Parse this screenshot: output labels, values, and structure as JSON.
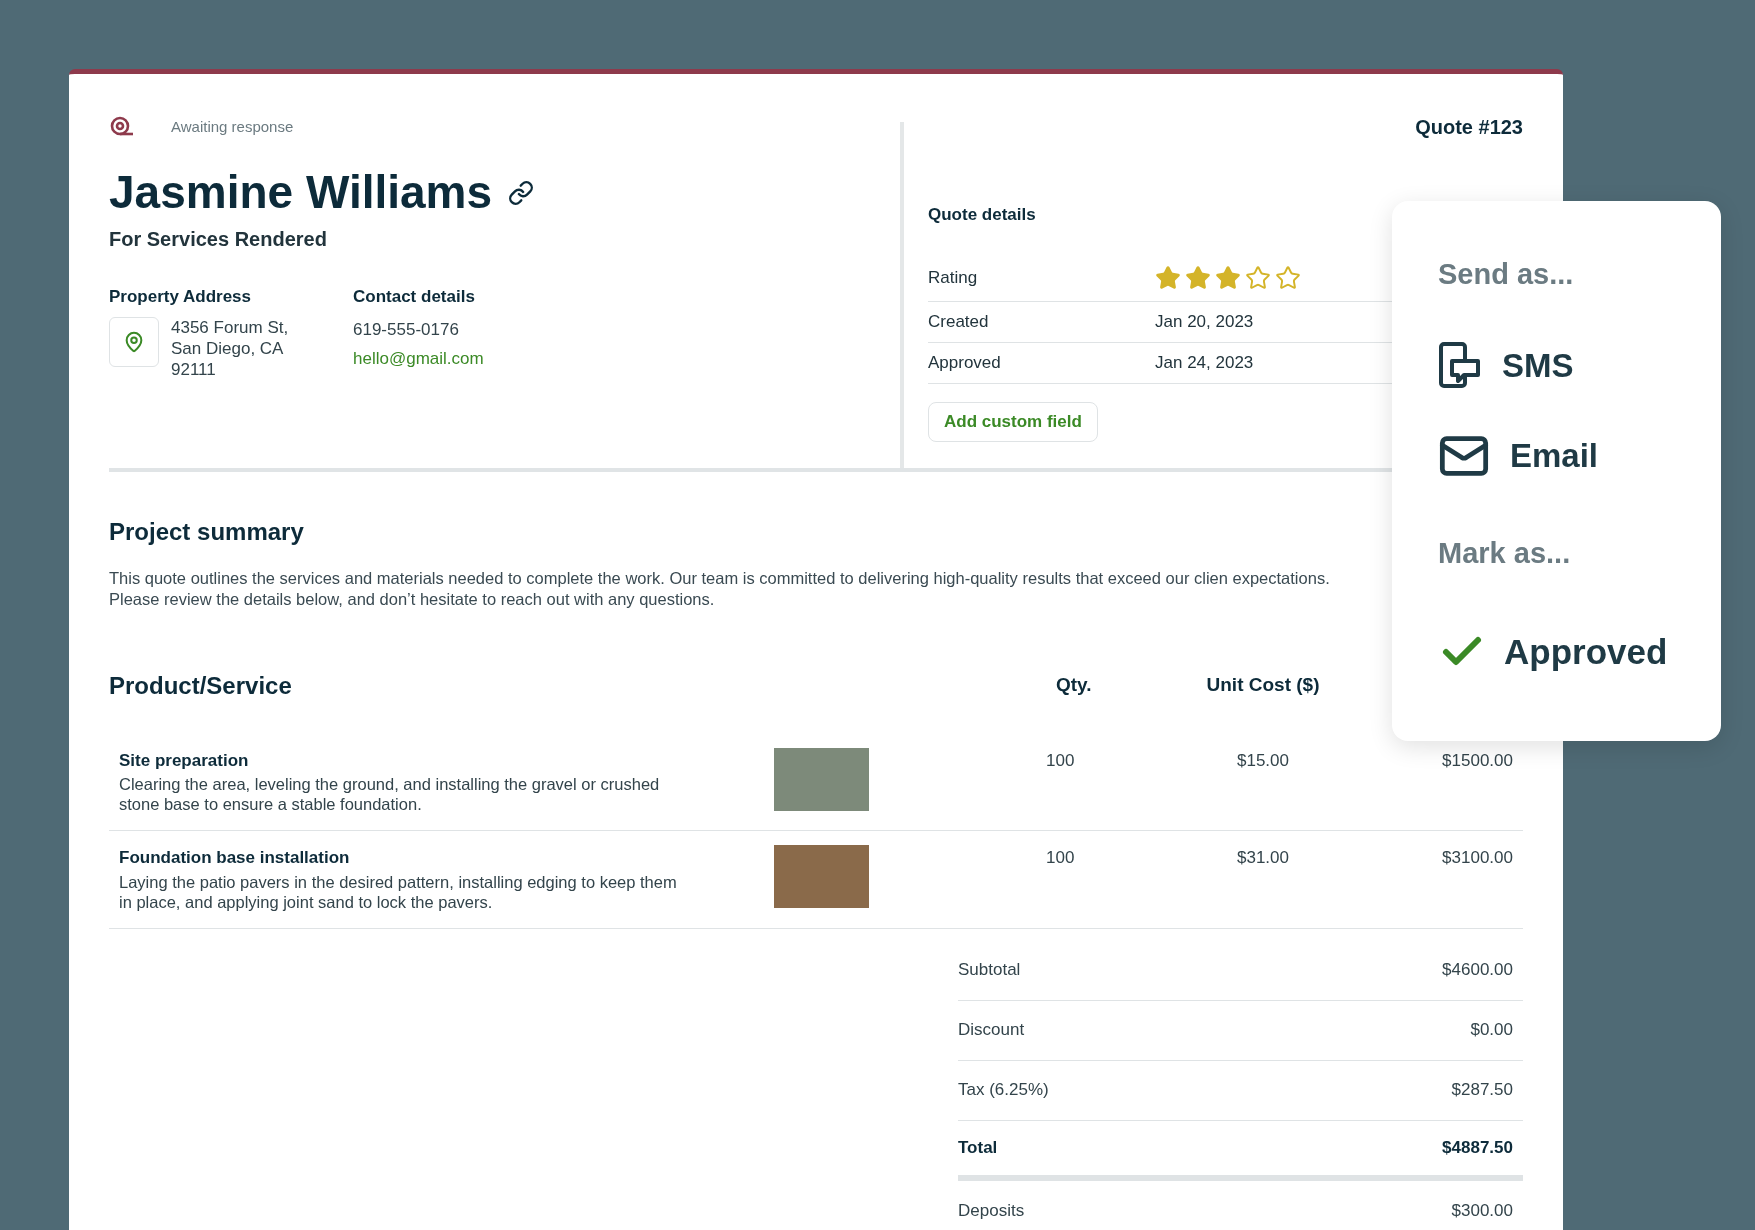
{
  "status": {
    "label": "Awaiting response"
  },
  "quote_number": "Quote #123",
  "client": {
    "name": "Jasmine Williams",
    "subtitle": "For Services Rendered"
  },
  "property_address": {
    "heading": "Property Address",
    "lines": [
      "4356 Forum St,",
      "San Diego, CA",
      "92111"
    ]
  },
  "contact": {
    "heading": "Contact details",
    "phone": "619-555-0176",
    "email": "hello@gmail.com"
  },
  "quote_details": {
    "title": "Quote details",
    "rating": {
      "label": "Rating",
      "stars": 3
    },
    "rows": [
      {
        "label": "Created",
        "value": "Jan 20, 2023"
      },
      {
        "label": "Approved",
        "value": "Jan 24, 2023"
      }
    ],
    "add_button": "Add custom field"
  },
  "project_summary": {
    "title": "Project summary",
    "text": "This quote outlines the services and materials needed to complete the work. Our team is committed to delivering high-quality results that exceed our clien expectations. Please review the details below, and don’t hesitate to reach out with any questions."
  },
  "table": {
    "columns": [
      "Product/Service",
      "Qty.",
      "Unit Cost ($)"
    ],
    "rows": [
      {
        "title": "Site preparation",
        "description": "Clearing the area, leveling the ground, and installing the gravel or crushed stone base to ensure a stable foundation.",
        "qty": "100",
        "unit_cost": "$15.00",
        "total": "$1500.00"
      },
      {
        "title": "Foundation base installation",
        "description": "Laying the patio pavers in the desired pattern, installing edging to keep them in place, and applying joint sand to lock the pavers.",
        "qty": "100",
        "unit_cost": "$31.00",
        "total": "$3100.00"
      }
    ]
  },
  "totals": [
    {
      "label": "Subtotal",
      "value": "$4600.00",
      "kind": "line"
    },
    {
      "label": "Discount",
      "value": "$0.00",
      "kind": "line"
    },
    {
      "label": "Tax (6.25%)",
      "value": "$287.50",
      "kind": "line"
    },
    {
      "label": "Total",
      "value": "$4887.50",
      "kind": "total"
    },
    {
      "label": "Deposits",
      "value": "$300.00",
      "kind": "line"
    }
  ],
  "popup": {
    "send_heading": "Send as...",
    "send_options": [
      {
        "label": "SMS",
        "kind": "sms"
      },
      {
        "label": "Email",
        "kind": "email"
      }
    ],
    "mark_heading": "Mark as...",
    "mark_options": [
      {
        "label": "Approved",
        "checked": true
      }
    ]
  }
}
